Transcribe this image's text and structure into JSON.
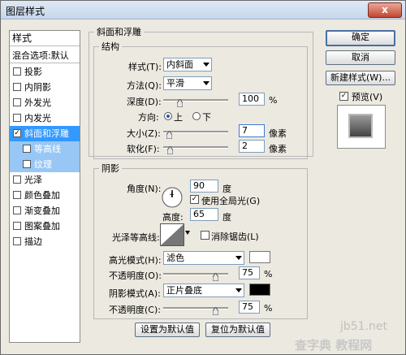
{
  "window": {
    "title": "图层样式",
    "close_glyph": "x"
  },
  "styles_panel": {
    "items": [
      {
        "label": "样式",
        "checkbox": false,
        "checked": false,
        "state": "normal"
      },
      {
        "label": "混合选项:默认",
        "checkbox": false,
        "checked": false,
        "state": "normal"
      },
      {
        "label": "投影",
        "checkbox": true,
        "checked": false,
        "state": "normal"
      },
      {
        "label": "内阴影",
        "checkbox": true,
        "checked": false,
        "state": "normal"
      },
      {
        "label": "外发光",
        "checkbox": true,
        "checked": false,
        "state": "normal"
      },
      {
        "label": "内发光",
        "checkbox": true,
        "checked": false,
        "state": "normal"
      },
      {
        "label": "斜面和浮雕",
        "checkbox": true,
        "checked": true,
        "state": "selected"
      },
      {
        "label": "等高线",
        "checkbox": true,
        "checked": false,
        "state": "sub"
      },
      {
        "label": "纹理",
        "checkbox": true,
        "checked": false,
        "state": "sub"
      },
      {
        "label": "光泽",
        "checkbox": true,
        "checked": false,
        "state": "normal"
      },
      {
        "label": "颜色叠加",
        "checkbox": true,
        "checked": false,
        "state": "normal"
      },
      {
        "label": "渐变叠加",
        "checkbox": true,
        "checked": false,
        "state": "normal"
      },
      {
        "label": "图案叠加",
        "checkbox": true,
        "checked": false,
        "state": "normal"
      },
      {
        "label": "描边",
        "checkbox": true,
        "checked": false,
        "state": "normal"
      }
    ]
  },
  "bevel": {
    "group_title": "斜面和浮雕",
    "structure_title": "结构",
    "style_label": "样式(T):",
    "style_value": "内斜面",
    "technique_label": "方法(Q):",
    "technique_value": "平滑",
    "depth_label": "深度(D):",
    "depth_value": "100",
    "depth_unit": "%",
    "direction_label": "方向:",
    "direction_up": "上",
    "direction_down": "下",
    "size_label": "大小(Z):",
    "size_value": "7",
    "size_unit": "像素",
    "soften_label": "软化(F):",
    "soften_value": "2",
    "soften_unit": "像素"
  },
  "shading": {
    "title": "阴影",
    "angle_label": "角度(N):",
    "angle_value": "90",
    "angle_unit": "度",
    "global_light_label": "使用全局光(G)",
    "altitude_label": "高度:",
    "altitude_value": "65",
    "altitude_unit": "度",
    "gloss_label": "光泽等高线:",
    "antialias_label": "消除锯齿(L)",
    "highlight_mode_label": "高光模式(H):",
    "highlight_mode_value": "滤色",
    "highlight_color": "#ffffff",
    "highlight_opacity_label": "不透明度(O):",
    "highlight_opacity_value": "75",
    "highlight_opacity_unit": "%",
    "shadow_mode_label": "阴影模式(A):",
    "shadow_mode_value": "正片叠底",
    "shadow_color": "#000000",
    "shadow_opacity_label": "不透明度(C):",
    "shadow_opacity_value": "75",
    "shadow_opacity_unit": "%"
  },
  "bottom_buttons": {
    "set_default": "设置为默认值",
    "reset_default": "复位为默认值"
  },
  "right_buttons": {
    "ok": "确定",
    "cancel": "取消",
    "new_style": "新建样式(W)...",
    "preview": "预览(V)"
  },
  "watermark": {
    "line1": "jb51.net",
    "line2": "查字典 教程网"
  }
}
